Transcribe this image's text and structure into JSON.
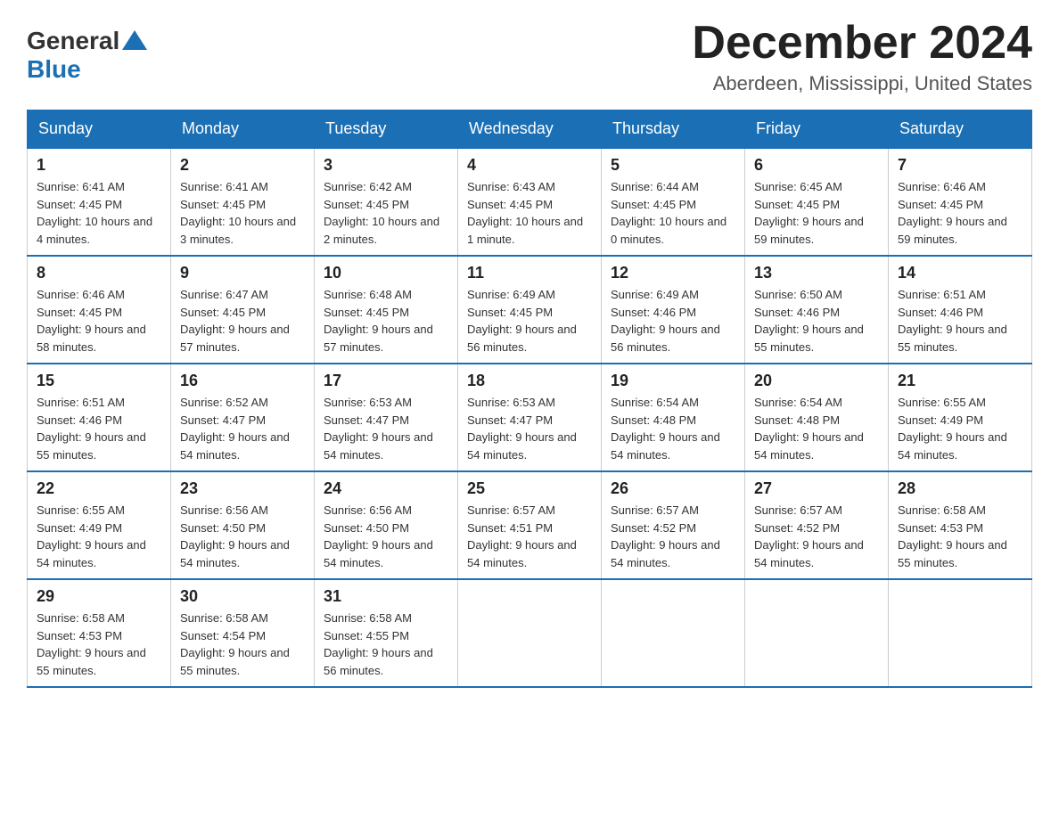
{
  "logo": {
    "general": "General",
    "blue": "Blue"
  },
  "title": "December 2024",
  "subtitle": "Aberdeen, Mississippi, United States",
  "weekdays": [
    "Sunday",
    "Monday",
    "Tuesday",
    "Wednesday",
    "Thursday",
    "Friday",
    "Saturday"
  ],
  "weeks": [
    [
      {
        "day": "1",
        "sunrise": "6:41 AM",
        "sunset": "4:45 PM",
        "daylight": "10 hours and 4 minutes."
      },
      {
        "day": "2",
        "sunrise": "6:41 AM",
        "sunset": "4:45 PM",
        "daylight": "10 hours and 3 minutes."
      },
      {
        "day": "3",
        "sunrise": "6:42 AM",
        "sunset": "4:45 PM",
        "daylight": "10 hours and 2 minutes."
      },
      {
        "day": "4",
        "sunrise": "6:43 AM",
        "sunset": "4:45 PM",
        "daylight": "10 hours and 1 minute."
      },
      {
        "day": "5",
        "sunrise": "6:44 AM",
        "sunset": "4:45 PM",
        "daylight": "10 hours and 0 minutes."
      },
      {
        "day": "6",
        "sunrise": "6:45 AM",
        "sunset": "4:45 PM",
        "daylight": "9 hours and 59 minutes."
      },
      {
        "day": "7",
        "sunrise": "6:46 AM",
        "sunset": "4:45 PM",
        "daylight": "9 hours and 59 minutes."
      }
    ],
    [
      {
        "day": "8",
        "sunrise": "6:46 AM",
        "sunset": "4:45 PM",
        "daylight": "9 hours and 58 minutes."
      },
      {
        "day": "9",
        "sunrise": "6:47 AM",
        "sunset": "4:45 PM",
        "daylight": "9 hours and 57 minutes."
      },
      {
        "day": "10",
        "sunrise": "6:48 AM",
        "sunset": "4:45 PM",
        "daylight": "9 hours and 57 minutes."
      },
      {
        "day": "11",
        "sunrise": "6:49 AM",
        "sunset": "4:45 PM",
        "daylight": "9 hours and 56 minutes."
      },
      {
        "day": "12",
        "sunrise": "6:49 AM",
        "sunset": "4:46 PM",
        "daylight": "9 hours and 56 minutes."
      },
      {
        "day": "13",
        "sunrise": "6:50 AM",
        "sunset": "4:46 PM",
        "daylight": "9 hours and 55 minutes."
      },
      {
        "day": "14",
        "sunrise": "6:51 AM",
        "sunset": "4:46 PM",
        "daylight": "9 hours and 55 minutes."
      }
    ],
    [
      {
        "day": "15",
        "sunrise": "6:51 AM",
        "sunset": "4:46 PM",
        "daylight": "9 hours and 55 minutes."
      },
      {
        "day": "16",
        "sunrise": "6:52 AM",
        "sunset": "4:47 PM",
        "daylight": "9 hours and 54 minutes."
      },
      {
        "day": "17",
        "sunrise": "6:53 AM",
        "sunset": "4:47 PM",
        "daylight": "9 hours and 54 minutes."
      },
      {
        "day": "18",
        "sunrise": "6:53 AM",
        "sunset": "4:47 PM",
        "daylight": "9 hours and 54 minutes."
      },
      {
        "day": "19",
        "sunrise": "6:54 AM",
        "sunset": "4:48 PM",
        "daylight": "9 hours and 54 minutes."
      },
      {
        "day": "20",
        "sunrise": "6:54 AM",
        "sunset": "4:48 PM",
        "daylight": "9 hours and 54 minutes."
      },
      {
        "day": "21",
        "sunrise": "6:55 AM",
        "sunset": "4:49 PM",
        "daylight": "9 hours and 54 minutes."
      }
    ],
    [
      {
        "day": "22",
        "sunrise": "6:55 AM",
        "sunset": "4:49 PM",
        "daylight": "9 hours and 54 minutes."
      },
      {
        "day": "23",
        "sunrise": "6:56 AM",
        "sunset": "4:50 PM",
        "daylight": "9 hours and 54 minutes."
      },
      {
        "day": "24",
        "sunrise": "6:56 AM",
        "sunset": "4:50 PM",
        "daylight": "9 hours and 54 minutes."
      },
      {
        "day": "25",
        "sunrise": "6:57 AM",
        "sunset": "4:51 PM",
        "daylight": "9 hours and 54 minutes."
      },
      {
        "day": "26",
        "sunrise": "6:57 AM",
        "sunset": "4:52 PM",
        "daylight": "9 hours and 54 minutes."
      },
      {
        "day": "27",
        "sunrise": "6:57 AM",
        "sunset": "4:52 PM",
        "daylight": "9 hours and 54 minutes."
      },
      {
        "day": "28",
        "sunrise": "6:58 AM",
        "sunset": "4:53 PM",
        "daylight": "9 hours and 55 minutes."
      }
    ],
    [
      {
        "day": "29",
        "sunrise": "6:58 AM",
        "sunset": "4:53 PM",
        "daylight": "9 hours and 55 minutes."
      },
      {
        "day": "30",
        "sunrise": "6:58 AM",
        "sunset": "4:54 PM",
        "daylight": "9 hours and 55 minutes."
      },
      {
        "day": "31",
        "sunrise": "6:58 AM",
        "sunset": "4:55 PM",
        "daylight": "9 hours and 56 minutes."
      },
      null,
      null,
      null,
      null
    ]
  ],
  "labels": {
    "sunrise": "Sunrise:",
    "sunset": "Sunset:",
    "daylight": "Daylight:"
  }
}
